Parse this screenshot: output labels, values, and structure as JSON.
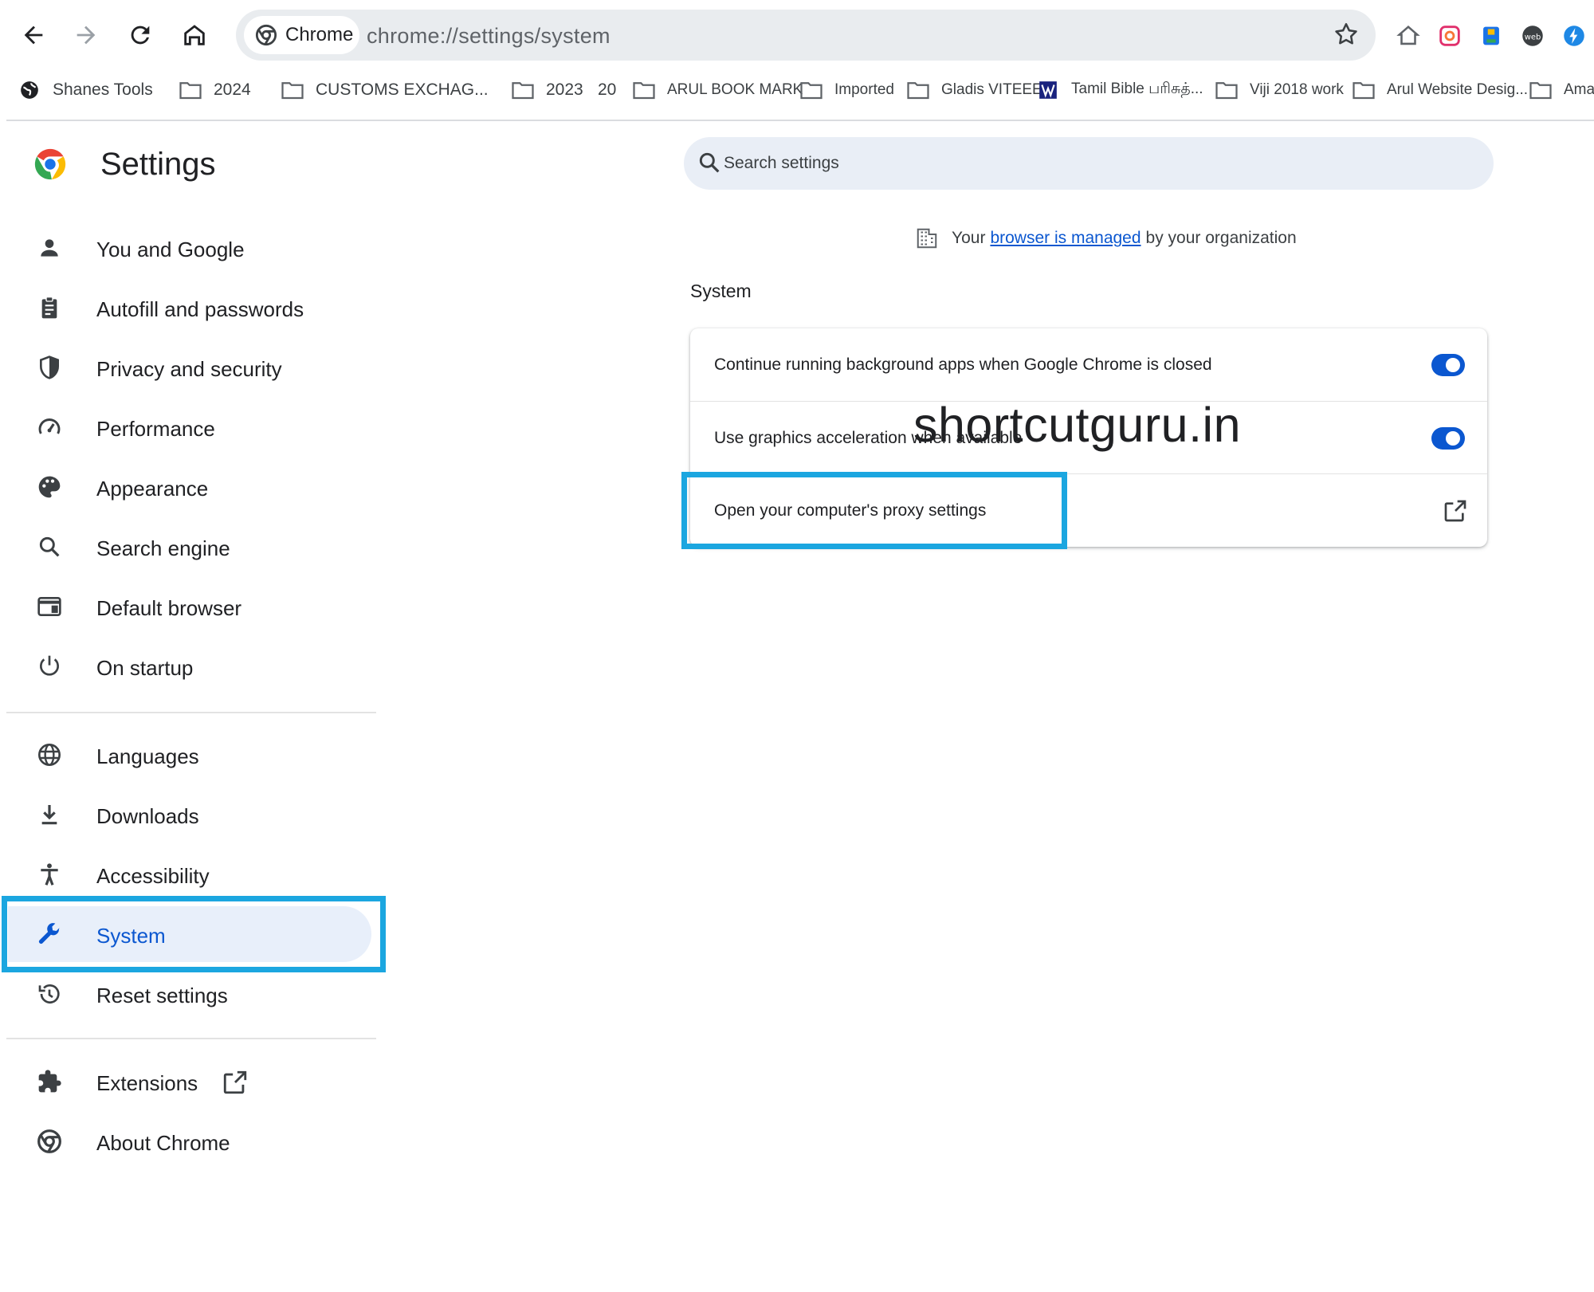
{
  "browser": {
    "chip_label": "Chrome",
    "url": "chrome://settings/system"
  },
  "bookmarks": [
    {
      "label": "Shanes Tools",
      "icon": "globe-icon"
    },
    {
      "label": "2024",
      "icon": "folder-icon"
    },
    {
      "label": "CUSTOMS EXCHAG...",
      "icon": "folder-icon"
    },
    {
      "label": "2023",
      "icon": "folder-icon"
    },
    {
      "label": "20",
      "icon": "folder-icon"
    },
    {
      "label": "ARUL BOOK MARK",
      "icon": "folder-icon"
    },
    {
      "label": "Imported",
      "icon": "folder-icon"
    },
    {
      "label": "Gladis VITEEE",
      "icon": "folder-icon"
    },
    {
      "label": "Tamil Bible பரிசுத்...",
      "icon": "bible-icon"
    },
    {
      "label": "Viji 2018 work",
      "icon": "folder-icon"
    },
    {
      "label": "Arul Website Desig...",
      "icon": "folder-icon"
    },
    {
      "label": "Amaz",
      "icon": "folder-icon"
    }
  ],
  "settings": {
    "title": "Settings",
    "search_placeholder": "Search settings",
    "managed_prefix": "Your",
    "managed_link": "browser is managed",
    "managed_suffix": "by your organization"
  },
  "sidebar": {
    "items": [
      {
        "label": "You and Google",
        "icon": "person-icon"
      },
      {
        "label": "Autofill and passwords",
        "icon": "clipboard-icon"
      },
      {
        "label": "Privacy and security",
        "icon": "shield-icon"
      },
      {
        "label": "Performance",
        "icon": "gauge-icon"
      },
      {
        "label": "Appearance",
        "icon": "palette-icon"
      },
      {
        "label": "Search engine",
        "icon": "search-icon"
      },
      {
        "label": "Default browser",
        "icon": "browser-window-icon"
      },
      {
        "label": "On startup",
        "icon": "power-icon"
      },
      {
        "label": "Languages",
        "icon": "globe-icon"
      },
      {
        "label": "Downloads",
        "icon": "download-icon"
      },
      {
        "label": "Accessibility",
        "icon": "accessibility-icon"
      },
      {
        "label": "System",
        "icon": "wrench-icon",
        "active": true
      },
      {
        "label": "Reset settings",
        "icon": "history-icon"
      },
      {
        "label": "Extensions",
        "icon": "puzzle-icon"
      },
      {
        "label": "About Chrome",
        "icon": "chrome-icon"
      }
    ]
  },
  "system": {
    "section_title": "System",
    "rows": [
      {
        "label": "Continue running background apps when Google Chrome is closed",
        "toggle": true
      },
      {
        "label": "Use graphics acceleration when available",
        "toggle": true
      },
      {
        "label": "Open your computer's proxy settings",
        "action": "external-link"
      }
    ]
  },
  "watermark": "shortcutguru.in",
  "colors": {
    "accent": "#0b57d0",
    "highlight_box": "#1ba6e0",
    "active_item_bg": "#e8effa"
  }
}
